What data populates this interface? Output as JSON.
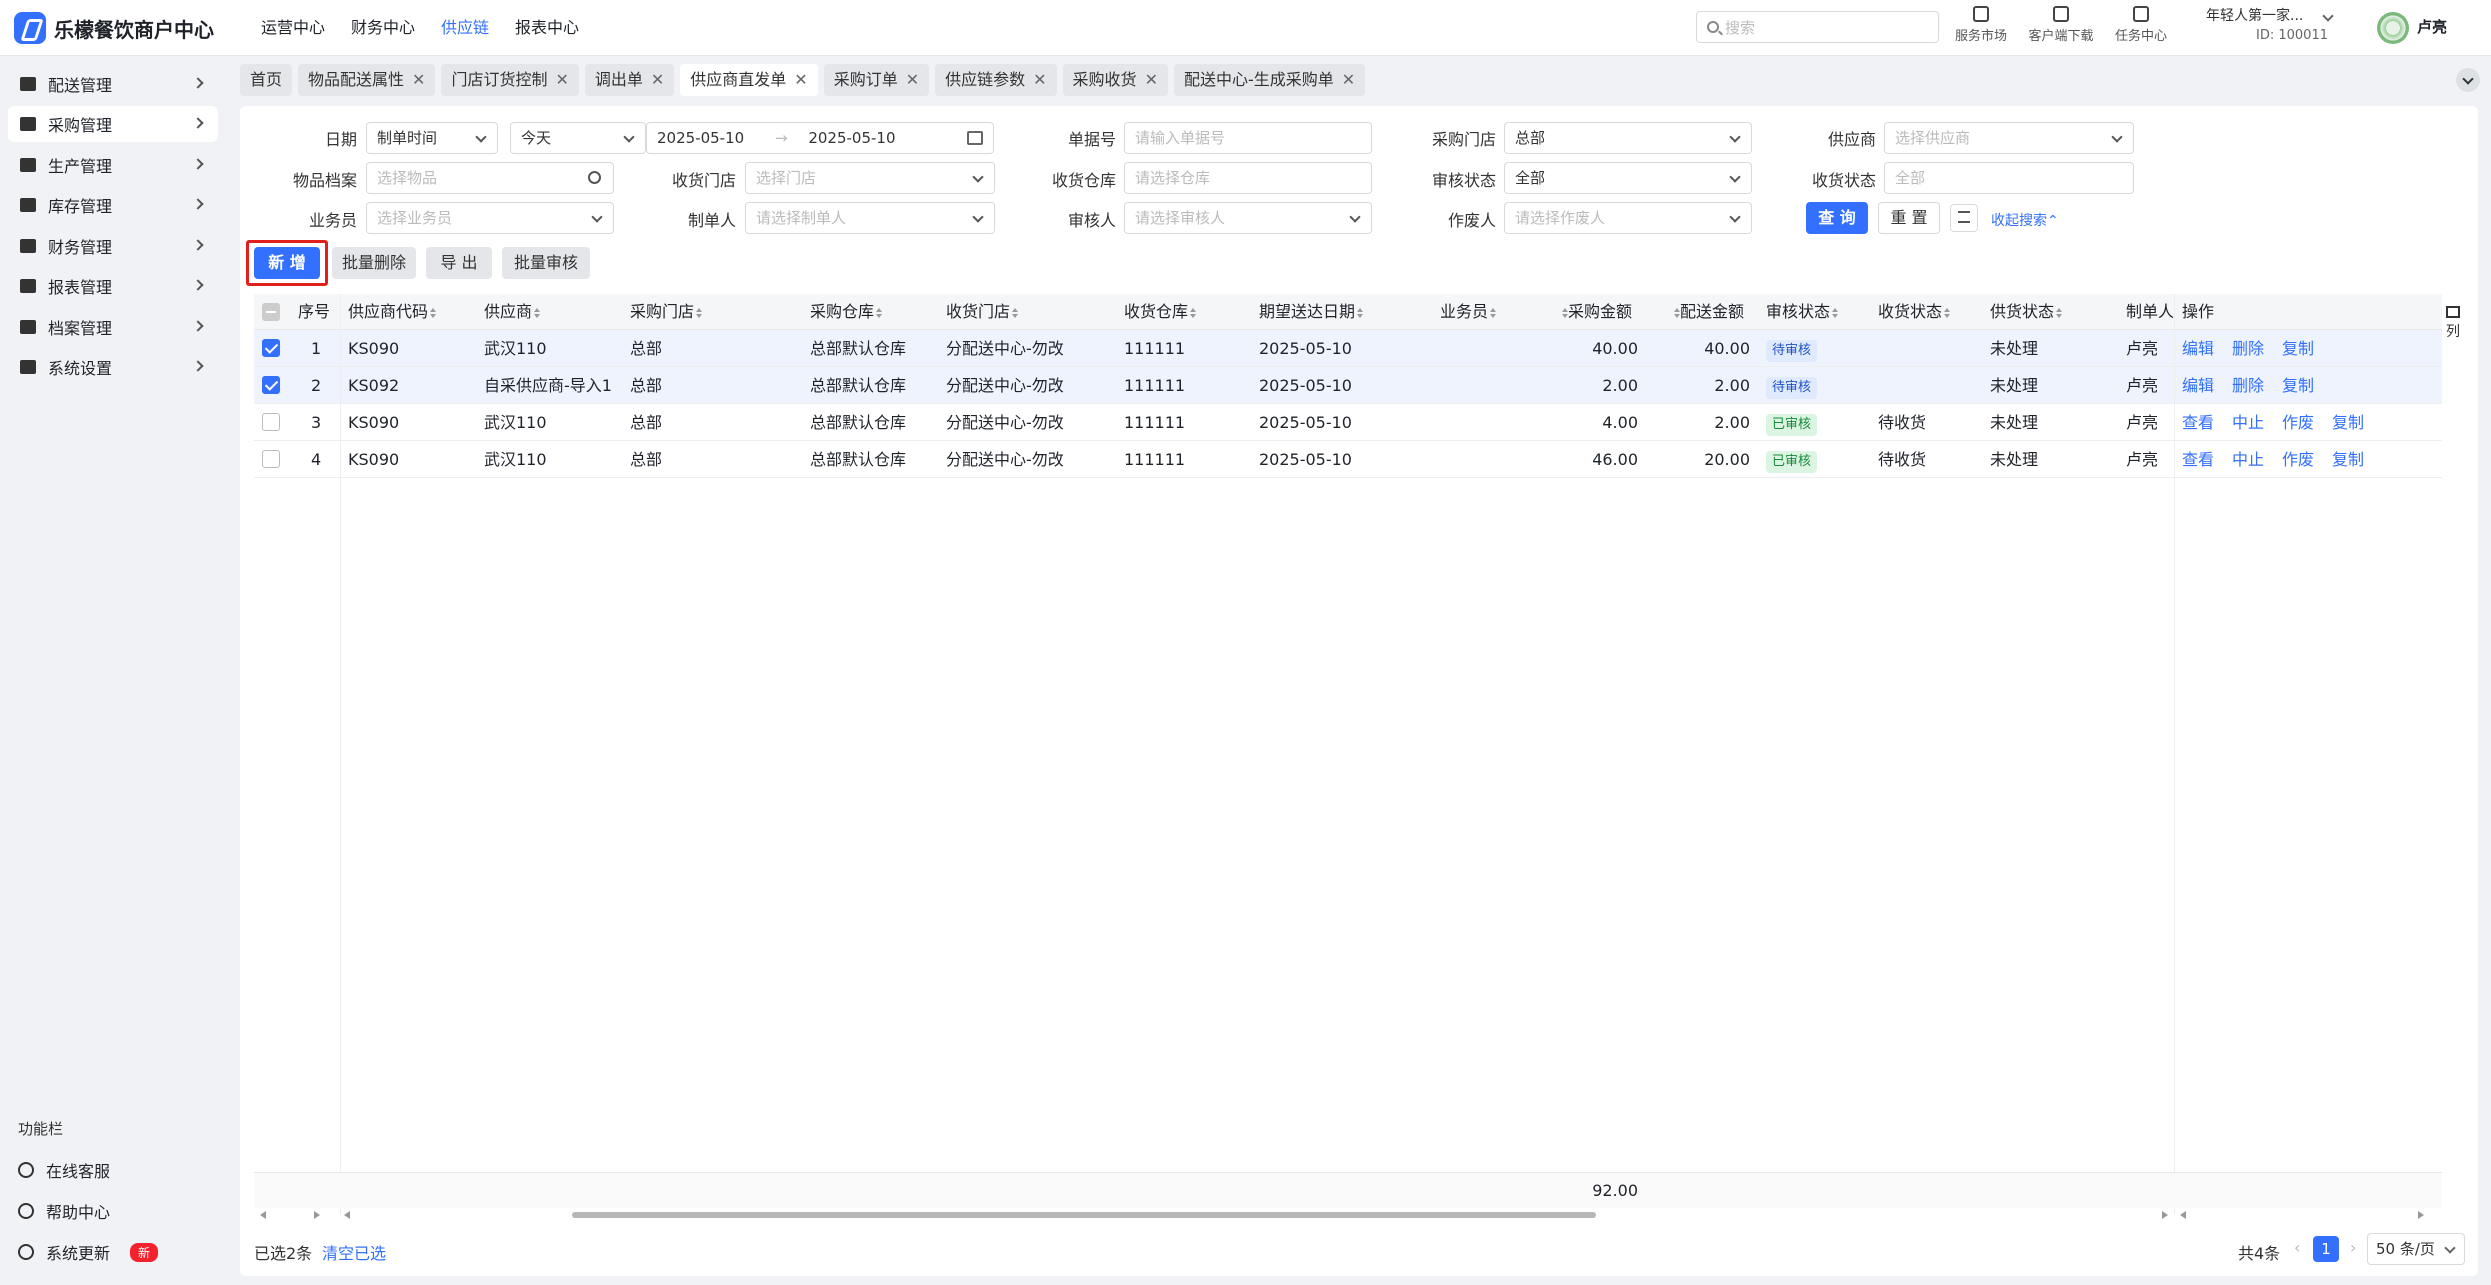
{
  "app": {
    "title": "乐檬餐饮商户中心"
  },
  "topnav": [
    {
      "label": "运营中心",
      "active": false
    },
    {
      "label": "财务中心",
      "active": false
    },
    {
      "label": "供应链",
      "active": true
    },
    {
      "label": "报表中心",
      "active": false
    }
  ],
  "search": {
    "placeholder": "搜索"
  },
  "tools": [
    {
      "label": "服务市场",
      "icon": "store-icon"
    },
    {
      "label": "客户端下载",
      "icon": "download-folder-icon"
    },
    {
      "label": "任务中心",
      "icon": "clipboard-icon"
    }
  ],
  "account": {
    "name": "年轻人第一家...",
    "id": "ID: 100011",
    "user": "卢亮"
  },
  "sidebar": {
    "items": [
      {
        "label": "配送管理",
        "icon": "truck-icon",
        "active": false
      },
      {
        "label": "采购管理",
        "icon": "inbox-icon",
        "active": true
      },
      {
        "label": "生产管理",
        "icon": "bar-chart-icon",
        "active": false
      },
      {
        "label": "库存管理",
        "icon": "warehouse-icon",
        "active": false
      },
      {
        "label": "财务管理",
        "icon": "ledger-icon",
        "active": false
      },
      {
        "label": "报表管理",
        "icon": "report-icon",
        "active": false
      },
      {
        "label": "档案管理",
        "icon": "archive-icon",
        "active": false
      },
      {
        "label": "系统设置",
        "icon": "gear-icon",
        "active": false
      }
    ],
    "func_title": "功能栏",
    "func_items": [
      {
        "label": "在线客服",
        "icon": "headset-icon"
      },
      {
        "label": "帮助中心",
        "icon": "help-icon"
      },
      {
        "label": "系统更新",
        "icon": "refresh-icon",
        "badge": "新"
      }
    ]
  },
  "tabs": [
    {
      "label": "首页",
      "closable": false,
      "active": false
    },
    {
      "label": "物品配送属性",
      "closable": true,
      "active": false
    },
    {
      "label": "门店订货控制",
      "closable": true,
      "active": false
    },
    {
      "label": "调出单",
      "closable": true,
      "active": false
    },
    {
      "label": "供应商直发单",
      "closable": true,
      "active": true
    },
    {
      "label": "采购订单",
      "closable": true,
      "active": false
    },
    {
      "label": "供应链参数",
      "closable": true,
      "active": false
    },
    {
      "label": "采购收货",
      "closable": true,
      "active": false
    },
    {
      "label": "配送中心-生成采购单",
      "closable": true,
      "active": false
    }
  ],
  "filters": {
    "date_label": "日期",
    "date_type": "制单时间",
    "date_preset": "今天",
    "date_from": "2025-05-10",
    "date_sep": "→",
    "date_to": "2025-05-10",
    "doc_no_label": "单据号",
    "doc_no_placeholder": "请输入单据号",
    "buy_store_label": "采购门店",
    "buy_store_value": "总部",
    "supplier_label": "供应商",
    "supplier_placeholder": "选择供应商",
    "item_label": "物品档案",
    "item_placeholder": "选择物品",
    "recv_store_label": "收货门店",
    "recv_store_placeholder": "选择门店",
    "recv_wh_label": "收货仓库",
    "recv_wh_placeholder": "请选择仓库",
    "audit_label": "审核状态",
    "audit_value": "全部",
    "recv_status_label": "收货状态",
    "recv_status_placeholder": "全部",
    "sales_label": "业务员",
    "sales_placeholder": "选择业务员",
    "maker_label": "制单人",
    "maker_placeholder": "请选择制单人",
    "auditor_label": "审核人",
    "auditor_placeholder": "请选择审核人",
    "voider_label": "作废人",
    "voider_placeholder": "请选择作废人",
    "query_btn": "查 询",
    "reset_btn": "重 置",
    "collapse_link": "收起搜索"
  },
  "actions": {
    "add": "新 增",
    "batch_delete": "批量删除",
    "export": "导 出",
    "batch_audit": "批量审核"
  },
  "table": {
    "headers": [
      "序号",
      "供应商代码",
      "供应商",
      "采购门店",
      "采购仓库",
      "收货门店",
      "收货仓库",
      "期望送达日期",
      "业务员",
      "采购金额",
      "配送金额",
      "审核状态",
      "收货状态",
      "供货状态",
      "制单人",
      "操作"
    ],
    "rows": [
      {
        "selected": true,
        "no": "1",
        "code": "KS090",
        "supplier": "武汉110",
        "store": "总部",
        "wh": "总部默认仓库",
        "recv_store": "分配送中心-勿改",
        "recv_wh": "111111",
        "date": "2025-05-10",
        "sales": "",
        "amount": "40.00",
        "dist_amount": "40.00",
        "audit": "待审核",
        "audit_kind": "pending",
        "recv": "",
        "supply": "未处理",
        "maker": "卢亮",
        "ops": [
          "编辑",
          "删除",
          "复制"
        ]
      },
      {
        "selected": true,
        "no": "2",
        "code": "KS092",
        "supplier": "自采供应商-导入1",
        "store": "总部",
        "wh": "总部默认仓库",
        "recv_store": "分配送中心-勿改",
        "recv_wh": "111111",
        "date": "2025-05-10",
        "sales": "",
        "amount": "2.00",
        "dist_amount": "2.00",
        "audit": "待审核",
        "audit_kind": "pending",
        "recv": "",
        "supply": "未处理",
        "maker": "卢亮",
        "ops": [
          "编辑",
          "删除",
          "复制"
        ]
      },
      {
        "selected": false,
        "no": "3",
        "code": "KS090",
        "supplier": "武汉110",
        "store": "总部",
        "wh": "总部默认仓库",
        "recv_store": "分配送中心-勿改",
        "recv_wh": "111111",
        "date": "2025-05-10",
        "sales": "",
        "amount": "4.00",
        "dist_amount": "2.00",
        "audit": "已审核",
        "audit_kind": "done",
        "recv": "待收货",
        "supply": "未处理",
        "maker": "卢亮",
        "ops": [
          "查看",
          "中止",
          "作废",
          "复制"
        ]
      },
      {
        "selected": false,
        "no": "4",
        "code": "KS090",
        "supplier": "武汉110",
        "store": "总部",
        "wh": "总部默认仓库",
        "recv_store": "分配送中心-勿改",
        "recv_wh": "111111",
        "date": "2025-05-10",
        "sales": "",
        "amount": "46.00",
        "dist_amount": "20.00",
        "audit": "已审核",
        "audit_kind": "done",
        "recv": "待收货",
        "supply": "未处理",
        "maker": "卢亮",
        "ops": [
          "查看",
          "中止",
          "作废",
          "复制"
        ]
      }
    ],
    "summary_amount": "92.00",
    "column_setting": "列"
  },
  "footer": {
    "selected_text": "已选2条",
    "clear_link": "清空已选",
    "total": "共4条",
    "page": "1",
    "page_size": "50 条/页"
  },
  "colors": {
    "primary": "#3370ff",
    "highlight_border": "#e0201b"
  }
}
